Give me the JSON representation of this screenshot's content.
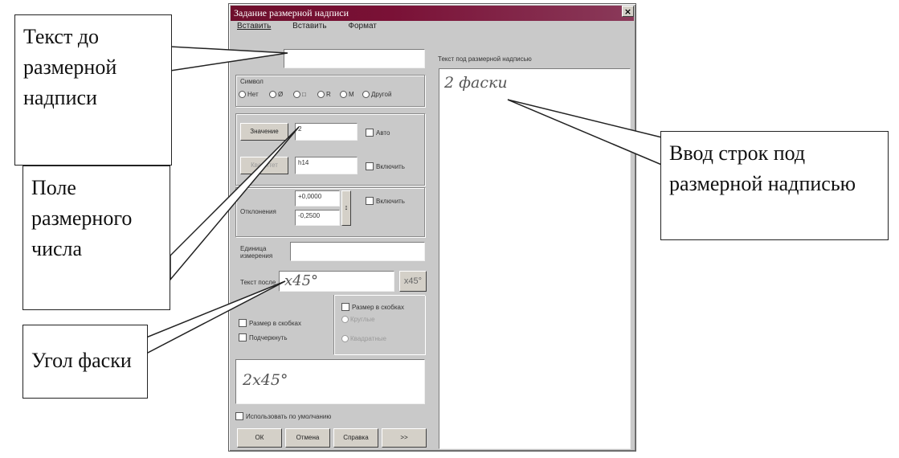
{
  "dialog": {
    "title": "Задание размерной надписи",
    "menu": [
      "Вставить",
      "Вставить",
      "Формат"
    ],
    "right_label": "Текст под размерной надписью",
    "right_text": "2 фаски",
    "symbol_group": {
      "label": "Символ",
      "options": [
        "Нет",
        "Ø",
        "□",
        "R",
        "M",
        "Другой"
      ]
    },
    "value_button": "Значение",
    "value_field": "2",
    "auto_checkbox": "Авто",
    "second_button": "Квалитет",
    "second_field": "h14",
    "include_checkbox_1": "Включить",
    "tolerance_label": "Отклонения",
    "tolerance_upper": "+0,0000",
    "tolerance_lower": "-0,2500",
    "include_checkbox_2": "Включить",
    "units_label": "Единица измерения",
    "text_after_label": "Текст после",
    "text_after_value": "x45°",
    "x45_button": "x45°",
    "size_checkbox": "Размер в скобках",
    "underline_checkbox": "Подчеркнуть",
    "size_checkbox_right": "Размер в скобках",
    "radio_a": "Круглые",
    "radio_b": "Квадратные",
    "preview_text": "2x45°",
    "default_checkbox": "Использовать по умолчанию",
    "buttons": [
      "ОК",
      "Отмена",
      "Справка",
      ">>"
    ]
  },
  "callouts": {
    "text_before": "Текст до размерной надписи",
    "dim_field": "Поле размерного числа",
    "chamfer_angle": "Угол фаски",
    "lines_under": "Ввод строк под размерной надписью"
  }
}
